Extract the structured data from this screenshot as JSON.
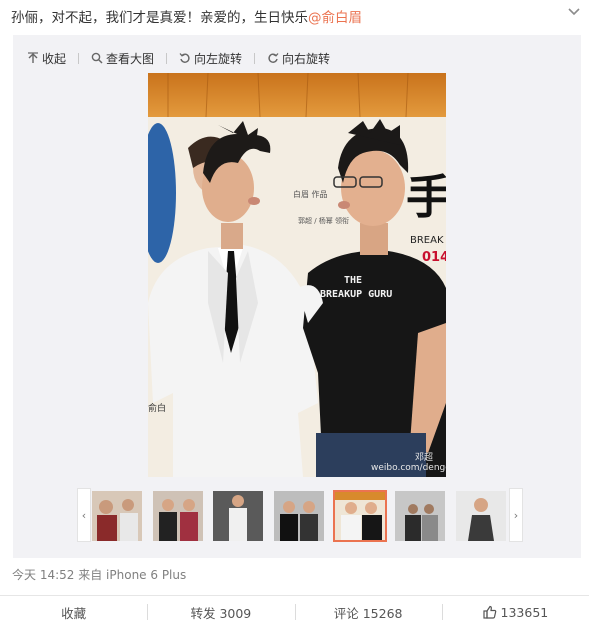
{
  "post": {
    "text": "孙俪，对不起，我们才是真爱！亲爱的，生日快乐",
    "mention": "@俞白眉"
  },
  "toolbar": {
    "collapse": "收起",
    "view_large": "查看大图",
    "rotate_left": "向左旋转",
    "rotate_right": "向右旋转"
  },
  "photo": {
    "shirt_line1": "THE",
    "shirt_line2": "BREAKUP GURU",
    "poster_chars": "手",
    "poster_break": "BREAK",
    "poster_year": "014",
    "poster_credit": "白眉 作品",
    "poster_cast": "郭超 / 杨幂 领衔",
    "poster_left": "俞白",
    "watermark_name": "邓超",
    "watermark_url": "weibo.com/dengchao"
  },
  "thumbnails": {
    "prev_icon": "chevron-left-icon",
    "next_icon": "chevron-right-icon",
    "count": 7,
    "selected_index": 4
  },
  "meta": {
    "time": "今天 14:52",
    "source": "来自 iPhone 6 Plus"
  },
  "actions": {
    "favorite": "收藏",
    "repost": "转发 3009",
    "comment": "评论 15268",
    "like": "133651"
  },
  "colors": {
    "accent": "#eb7350",
    "panel_bg": "#f2f2f5"
  }
}
